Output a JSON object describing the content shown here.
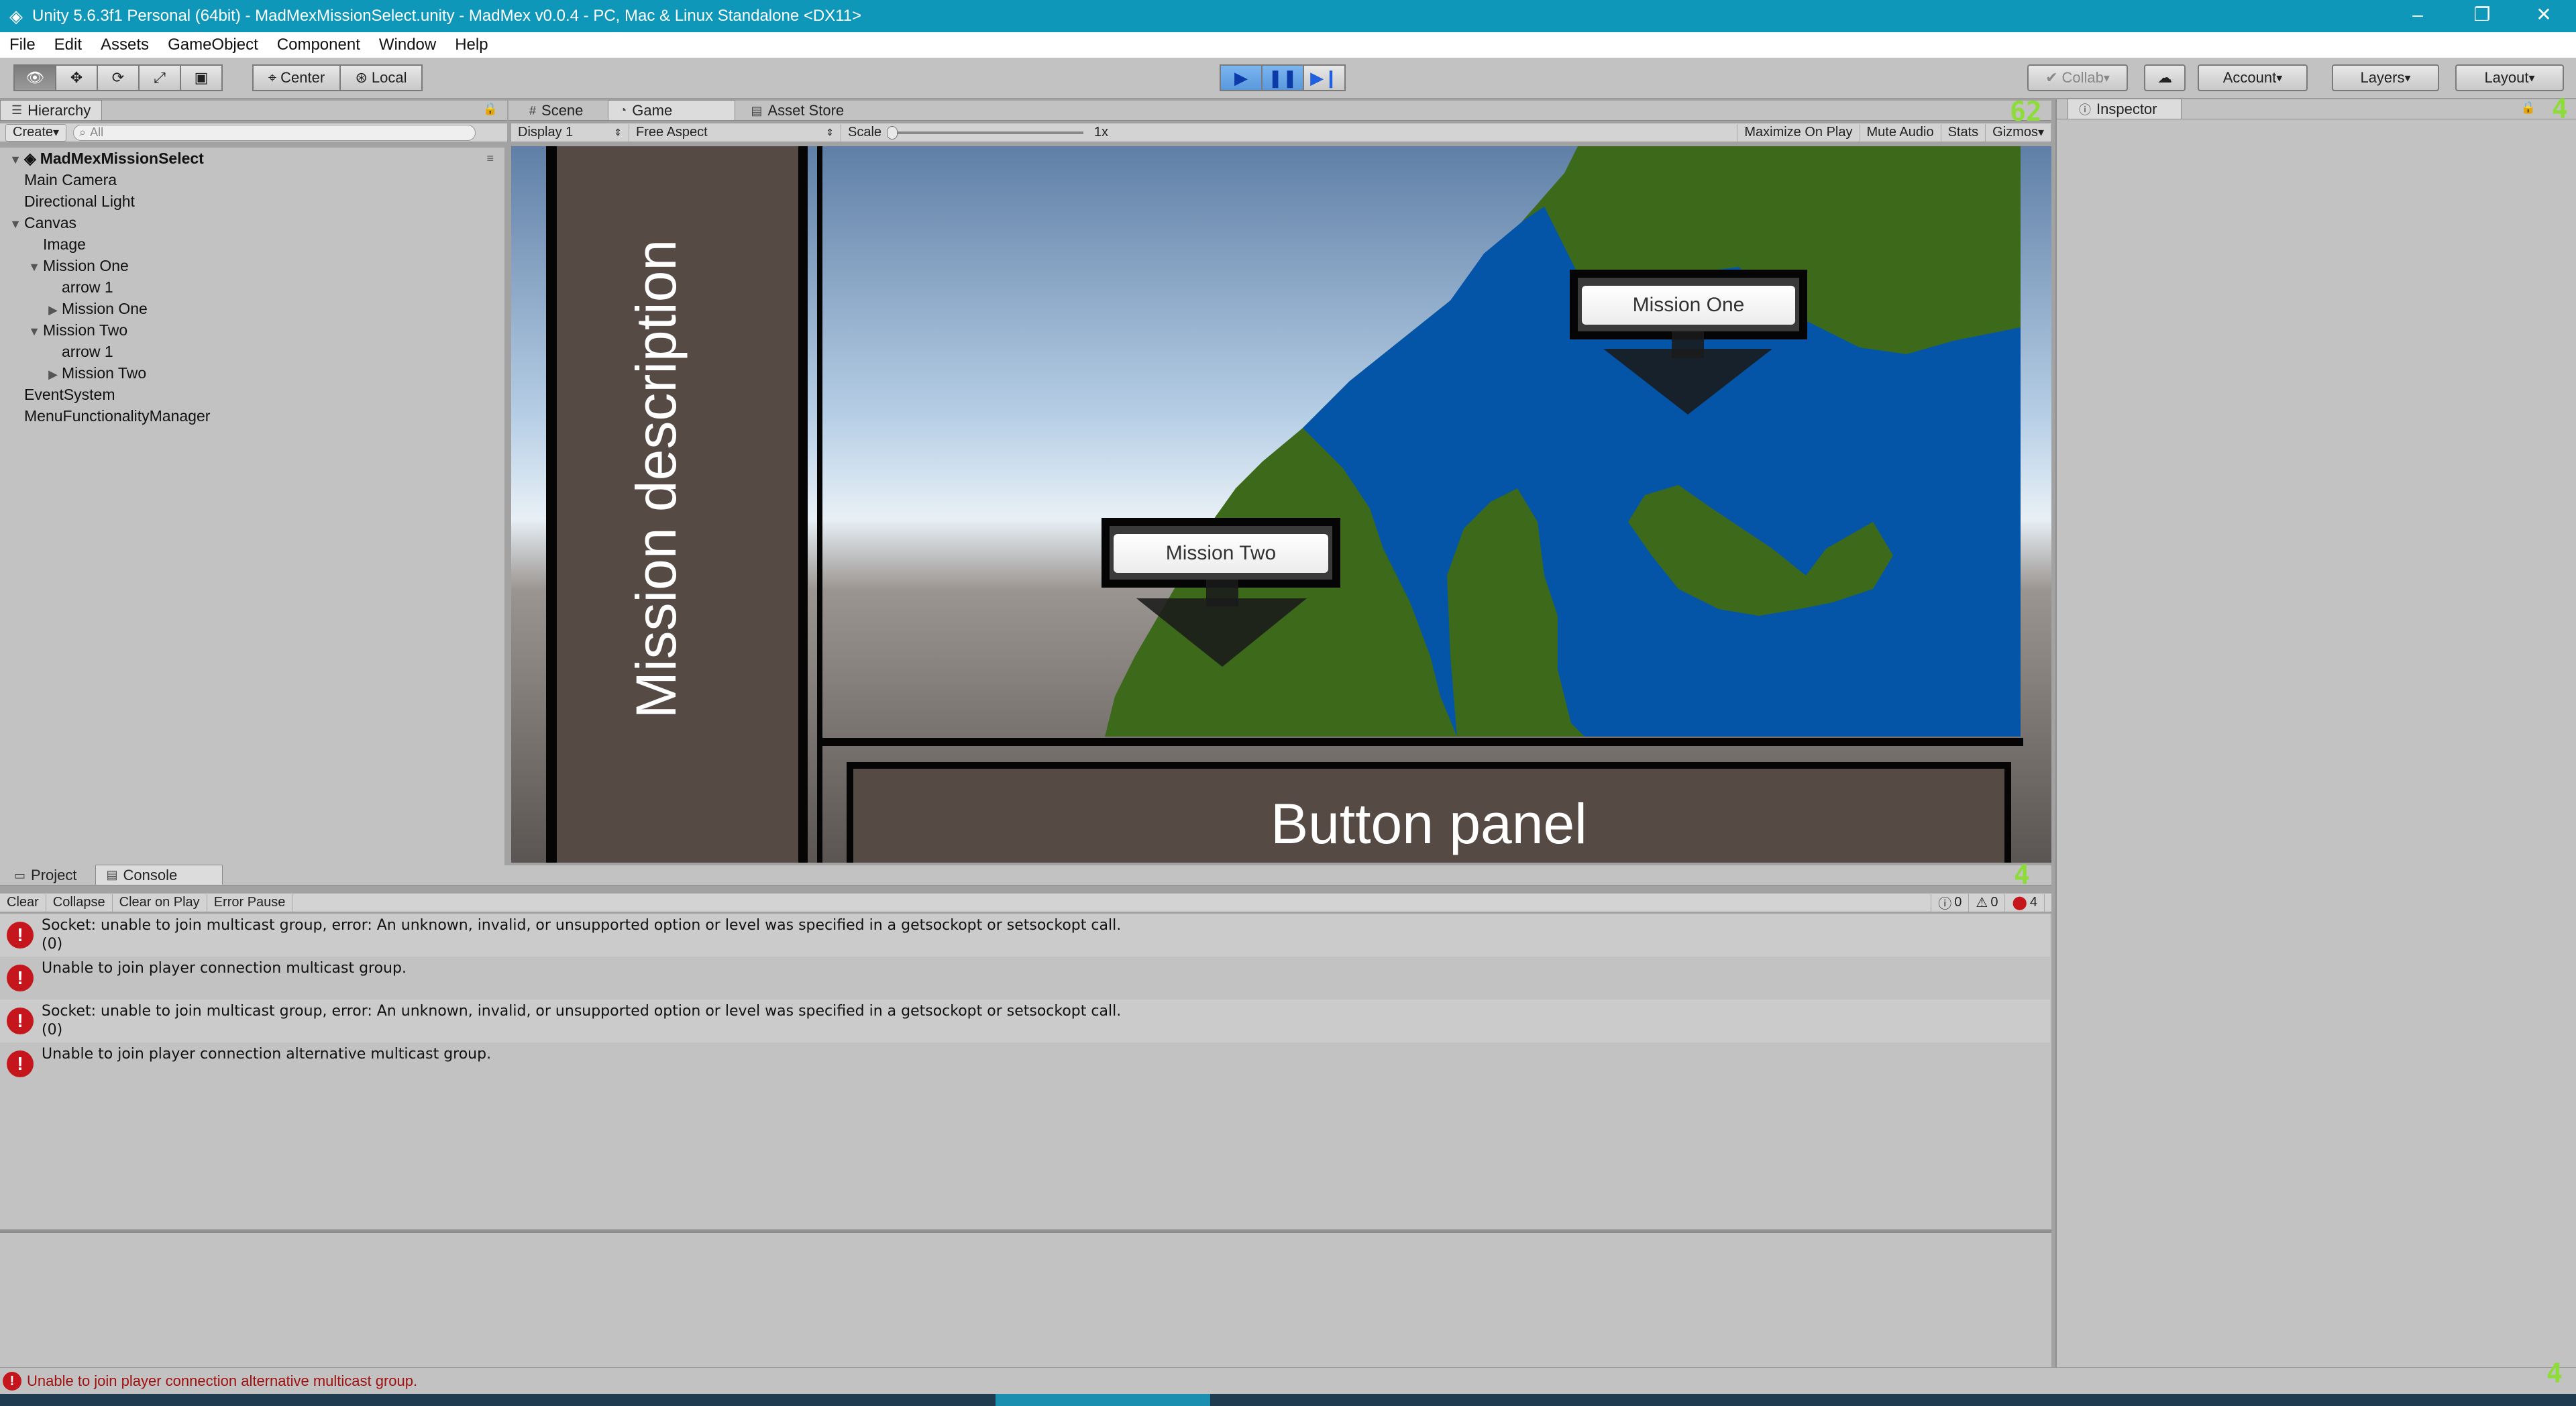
{
  "window": {
    "title": "Unity 5.6.3f1 Personal (64bit) - MadMexMissionSelect.unity - MadMex v0.0.4 - PC, Mac & Linux Standalone <DX11>",
    "minimize": "–",
    "restore": "❐",
    "close": "✕"
  },
  "menu": [
    "File",
    "Edit",
    "Assets",
    "GameObject",
    "Component",
    "Window",
    "Help"
  ],
  "toolbar": {
    "tools": [
      "view",
      "move",
      "rotate",
      "scale",
      "rect"
    ],
    "pivot_center": "Center",
    "pivot_local": "Local",
    "collab": "Collab",
    "account": "Account",
    "layers": "Layers",
    "layout": "Layout"
  },
  "hierarchy": {
    "tab": "Hierarchy",
    "create": "Create",
    "search_placeholder": "All",
    "scene": "MadMexMissionSelect",
    "items": [
      {
        "label": "Main Camera",
        "depth": 1,
        "arrow": ""
      },
      {
        "label": "Directional Light",
        "depth": 1,
        "arrow": ""
      },
      {
        "label": "Canvas",
        "depth": 1,
        "arrow": "▼"
      },
      {
        "label": "Image",
        "depth": 2,
        "arrow": ""
      },
      {
        "label": "Mission One",
        "depth": 2,
        "arrow": "▼"
      },
      {
        "label": "arrow 1",
        "depth": 3,
        "arrow": ""
      },
      {
        "label": "Mission One",
        "depth": 3,
        "arrow": "▶"
      },
      {
        "label": "Mission Two",
        "depth": 2,
        "arrow": "▼"
      },
      {
        "label": "arrow 1",
        "depth": 3,
        "arrow": ""
      },
      {
        "label": "Mission Two",
        "depth": 3,
        "arrow": "▶"
      },
      {
        "label": "EventSystem",
        "depth": 1,
        "arrow": ""
      },
      {
        "label": "MenuFunctionalityManager",
        "depth": 1,
        "arrow": ""
      }
    ]
  },
  "scene_tabs": {
    "scene": "Scene",
    "game": "Game",
    "asset_store": "Asset Store"
  },
  "game_bar": {
    "display": "Display 1",
    "aspect": "Free Aspect",
    "scale_label": "Scale",
    "scale_value": "1x",
    "maximize": "Maximize On Play",
    "mute": "Mute Audio",
    "stats": "Stats",
    "gizmos": "Gizmos"
  },
  "game": {
    "mission_description": "Mission description",
    "button_panel": "Button panel",
    "mission_one": "Mission One",
    "mission_two": "Mission Two"
  },
  "inspector": {
    "tab": "Inspector"
  },
  "bottom_tabs": {
    "project": "Project",
    "console": "Console"
  },
  "console": {
    "clear": "Clear",
    "collapse": "Collapse",
    "clear_on_play": "Clear on Play",
    "error_pause": "Error Pause",
    "info_count": "0",
    "warn_count": "0",
    "error_count": "4",
    "entries": [
      {
        "line1": "Socket: unable to join multicast group, error: An unknown, invalid, or unsupported option or level was specified in a getsockopt or setsockopt call.",
        "line2": "(0)"
      },
      {
        "line1": "Unable to join player connection multicast group.",
        "line2": ""
      },
      {
        "line1": "Socket: unable to join multicast group, error: An unknown, invalid, or unsupported option or level was specified in a getsockopt or setsockopt call.",
        "line2": "(0)"
      },
      {
        "line1": "Unable to join player connection alternative multicast group.",
        "line2": ""
      }
    ]
  },
  "status": {
    "message": "Unable to join player connection alternative multicast group."
  },
  "colors": {
    "titlebar": "#0e97b8",
    "sea": "#0455a8",
    "land": "#3c6a1a",
    "panel_fill": "#564a45",
    "error": "#c4161c"
  }
}
